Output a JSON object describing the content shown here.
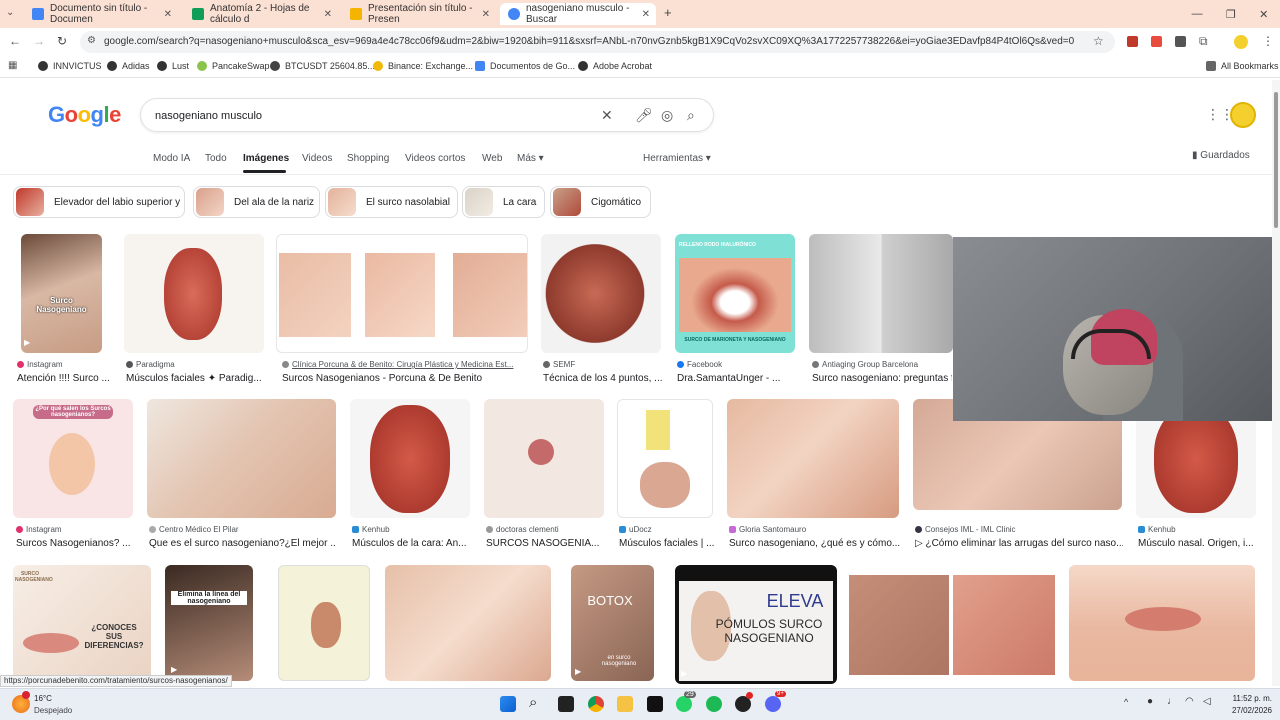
{
  "browser": {
    "tabs": [
      {
        "title": "Documento sin título - Documen",
        "color": "#4285f4"
      },
      {
        "title": "Anatomía 2 - Hojas de cálculo d",
        "color": "#0f9d58"
      },
      {
        "title": "Presentación sin título - Presen",
        "color": "#f4b400"
      },
      {
        "title": "nasogeniano musculo - Buscar",
        "color": "#4285f4"
      }
    ],
    "new_tab": "+",
    "url": "google.com/search?q=nasogeniano+musculo&sca_esv=969a4e4c78cc06f9&udm=2&biw=1920&bih=911&sxsrf=ANbL-n70nvGznb5kgB1X9CqVo2svXC09XQ%3A1772257738226&ei=yoGiae3EDavfp84P4tOl6Qs&ved=0ahUKEwjt0b_Hvvu...",
    "bookmarks": [
      "INNVICTUS",
      "Adidas",
      "Lust",
      "PancakeSwap",
      "BTCUSDT 25604.85...",
      "Binance: Exchange...",
      "Documentos de Go...",
      "Adobe Acrobat"
    ],
    "all_bookmarks": "All Bookmarks"
  },
  "google": {
    "logo": "Google",
    "query": "nasogeniano musculo",
    "nav_tabs": [
      "Modo IA",
      "Todo",
      "Imágenes",
      "Videos",
      "Shopping",
      "Videos cortos",
      "Web",
      "Más"
    ],
    "tools": "Herramientas",
    "saved": "Guardados",
    "chips": [
      "Elevador del labio superior y",
      "Del ala de la nariz",
      "El surco nasolabial",
      "La cara",
      "Cigomático"
    ]
  },
  "results": [
    {
      "source": "Instagram",
      "title": "Atención !!!! Surco ..."
    },
    {
      "source": "Paradigma",
      "title": "Músculos faciales ✦ Paradig..."
    },
    {
      "source": "Clínica Porcuna & de Benito: Cirugía Plástica y Medicina Est...",
      "title": "Surcos Nasogenianos - Porcuna & De Benito"
    },
    {
      "source": "SEMF",
      "title": "Técnica de los 4 puntos, ..."
    },
    {
      "source": "Facebook",
      "title": "Dra.SamantaUnger - ..."
    },
    {
      "source": "Antiaging Group Barcelona",
      "title": "Surco nasogeniano: preguntas fre..."
    },
    {
      "source": "Instagram",
      "title": "Surcos Nasogenianos? ..."
    },
    {
      "source": "Centro Médico El Pilar",
      "title": "Que es el surco nasogeniano?¿El mejor ..."
    },
    {
      "source": "Kenhub",
      "title": "Músculos de la cara: An..."
    },
    {
      "source": "doctoras clementi",
      "title": "SURCOS NASOGENIA..."
    },
    {
      "source": "uDocz",
      "title": "Músculos faciales | ..."
    },
    {
      "source": "Gloria Santomauro",
      "title": "Surco nasogeniano, ¿qué es y cómo..."
    },
    {
      "source": "Consejos IML - IML Clinic",
      "title": "▷ ¿Cómo eliminar las arrugas del surco naso..."
    },
    {
      "source": "Kenhub",
      "title": "Músculo nasal. Origen, i..."
    }
  ],
  "image_texts": {
    "surco_nasogeniano": "Surco Nasogeniano",
    "por_que_salen": "¿Por qué salen los Surcos nasogenianos?",
    "relleno": "RELLENO RODO HIALURÓNICO",
    "surco_marioneta": "SURCO DE MARIONETA Y NASOGENIANO",
    "conoces": "¿CONOCES SUS DIFERENCIAS?",
    "surco_label": "SURCO NASOGENIANO",
    "elimina": "Elimina la línea del nasogeniano",
    "botox": "BOTOX",
    "en_surco": "en surco nasogeniano",
    "eleva": "ELEVA",
    "pomulos": "PÓMULOS SURCO NASOGENIANO"
  },
  "status_url": "https://porcunadebenito.com/tratamiento/surcos-nasogenianos/",
  "taskbar": {
    "temp": "16°C",
    "weather": "Despejado",
    "time": "11:52 p. m.",
    "date": "27/02/2026",
    "badge_whatsapp": "29",
    "badge_discord": "9+"
  }
}
